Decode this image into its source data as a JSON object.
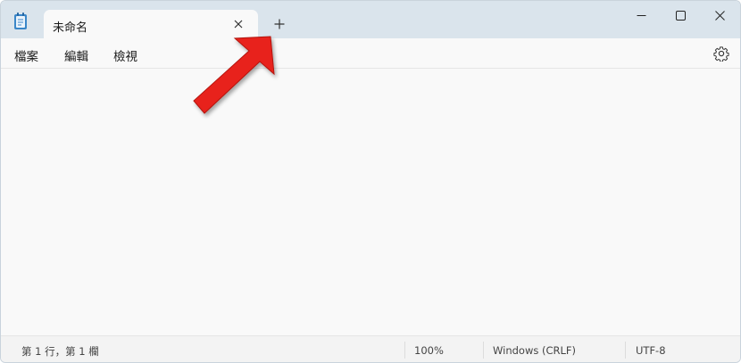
{
  "tab": {
    "title": "未命名"
  },
  "menu": {
    "file": "檔案",
    "edit": "編輯",
    "view": "檢視"
  },
  "status": {
    "position": "第 1 行，第 1 欄",
    "zoom": "100%",
    "line_ending": "Windows (CRLF)",
    "encoding": "UTF-8"
  },
  "icons": {
    "app": "notepad-icon",
    "tab_close": "close-icon",
    "new_tab": "plus-icon",
    "minimize": "minimize-icon",
    "maximize": "maximize-icon",
    "close": "close-icon",
    "settings": "gear-icon",
    "annotation": "red-arrow"
  },
  "colors": {
    "titlebar": "#dae4ec",
    "surface": "#f9f9f9",
    "statusbar": "#f3f3f3",
    "arrow": "#e8211b"
  }
}
